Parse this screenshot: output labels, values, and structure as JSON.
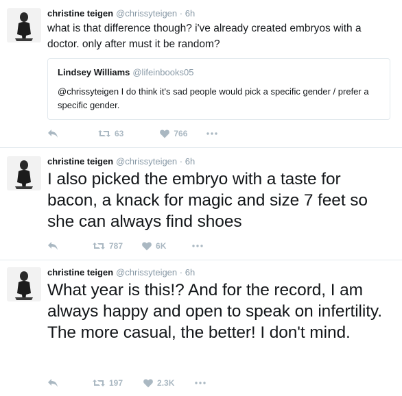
{
  "tweets": [
    {
      "name": "christine teigen",
      "handle": "@chrissyteigen",
      "sep": "·",
      "time": "6h",
      "text": "what is that difference though? i've already created embryos with a doctor. only after must it be random?",
      "quote": {
        "name": "Lindsey Williams",
        "handle": "@lifeinbooks05",
        "text": "@chrissyteigen I do think it's sad people would pick a specific gender / prefer a specific gender."
      },
      "retweets": "63",
      "likes": "766"
    },
    {
      "name": "christine teigen",
      "handle": "@chrissyteigen",
      "sep": "·",
      "time": "6h",
      "text": "I also picked the embryo with a taste for bacon, a knack for magic and size 7 feet so she can always find shoes",
      "retweets": "787",
      "likes": "6K"
    },
    {
      "name": "christine teigen",
      "handle": "@chrissyteigen",
      "sep": "·",
      "time": "6h",
      "text": "What year is this!? And for the record, I am always happy and open to speak on infertility. The more casual, the better! I don't mind.",
      "retweets": "197",
      "likes": "2.3K"
    }
  ],
  "icons": {
    "reply": "reply-icon",
    "retweet": "retweet-icon",
    "like": "heart-icon",
    "more": "more-icon"
  },
  "colors": {
    "action_gray": "#aab8c2",
    "meta_gray": "#8899a6",
    "divider": "#e1e8ed",
    "text": "#14171a"
  }
}
